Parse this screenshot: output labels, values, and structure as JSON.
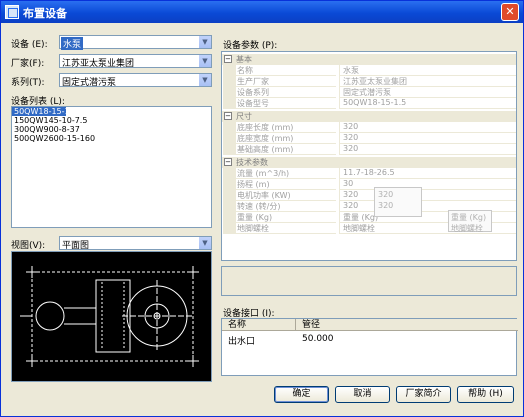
{
  "window": {
    "title": "布置设备",
    "close_label": "✕"
  },
  "left": {
    "equipment": {
      "label": "设备 (E):",
      "value": "水泵"
    },
    "manufacturer": {
      "label": "厂家(F):",
      "value": "江苏亚太泵业集团"
    },
    "series": {
      "label": "系列(T):",
      "value": "固定式潜污泵"
    },
    "list_label": "设备列表 (L):",
    "list_items": [
      "50QW18-15-1.5",
      "150QW145-10-7.5",
      "300QW900-8-37",
      "500QW2600-15-160"
    ],
    "view": {
      "label": "视图(V):",
      "value": "平面图"
    }
  },
  "params": {
    "label": "设备参数 (P):",
    "categories": [
      {
        "name": "基本",
        "rows": [
          {
            "k": "名称",
            "v": "水泵"
          },
          {
            "k": "生产厂家",
            "v": "江苏亚太泵业集团"
          },
          {
            "k": "设备系列",
            "v": "固定式潜污泵"
          },
          {
            "k": "设备型号",
            "v": "50QW18-15-1.5"
          }
        ]
      },
      {
        "name": "尺寸",
        "rows": [
          {
            "k": "底座长度 (mm)",
            "v": "320"
          },
          {
            "k": "底座宽度 (mm)",
            "v": "320"
          },
          {
            "k": "基础高度 (mm)",
            "v": "320"
          }
        ]
      },
      {
        "name": "技术参数",
        "rows": [
          {
            "k": "流量 (m^3/h)",
            "v": "11.7-18-26.5"
          },
          {
            "k": "扬程 (m)",
            "v": "30"
          },
          {
            "k": "电机功率 (KW)",
            "v": "320"
          },
          {
            "k": "转速 (转/分)",
            "v": "320"
          },
          {
            "k": "重量 (Kg)",
            "v": "重量 (Kg)"
          },
          {
            "k": "地脚螺栓",
            "v": "地脚螺栓"
          }
        ]
      }
    ],
    "ghost_a": {
      "r1": "320",
      "r2": "320"
    },
    "ghost_b": {
      "k": "重量 (Kg)",
      "k2": "地脚螺栓"
    }
  },
  "ports": {
    "label": "设备接口 (I):",
    "columns": [
      "名称",
      "管径"
    ],
    "rows": [
      {
        "name": "出水口",
        "diameter": "50.000"
      }
    ]
  },
  "buttons": {
    "ok": "确定",
    "cancel": "取消",
    "intro": "厂家简介",
    "help": "帮助 (H)"
  }
}
